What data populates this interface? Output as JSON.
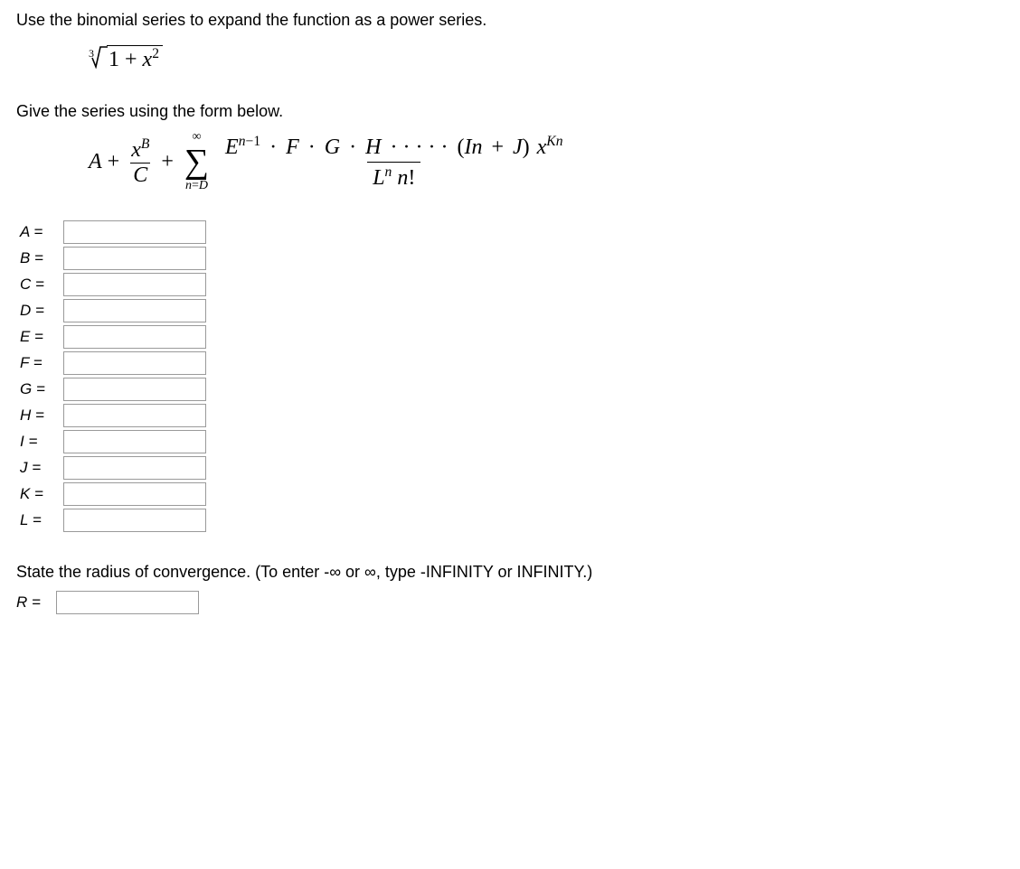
{
  "question": {
    "prompt1": "Use the binomial series to expand the function as a power series.",
    "root_index": "3",
    "radicand_prefix": "1 + ",
    "radicand_var": "x",
    "radicand_exp": "2",
    "prompt2": "Give the series using the form below.",
    "series": {
      "A": "A",
      "plus1": "+",
      "frac_num_var": "x",
      "frac_num_exp": "B",
      "frac_den": "C",
      "plus2": "+",
      "sigma_top": "∞",
      "sigma_sym": "∑",
      "sigma_bot_lhs": "n",
      "sigma_bot_eq": "=",
      "sigma_bot_rhs": "D",
      "big_num_E": "E",
      "big_num_E_exp_lhs": "n",
      "big_num_E_exp_op": "−",
      "big_num_E_exp_rhs": "1",
      "dot": "·",
      "F": "F",
      "G": "G",
      "H": "H",
      "dots": "· · · · ·",
      "lparen": "(",
      "I": "I",
      "n": "n",
      "plus3": "+",
      "J": "J",
      "rparen": ")",
      "x": "x",
      "Kn_K": "K",
      "Kn_n": "n",
      "den_L": "L",
      "den_L_exp": "n",
      "den_space": " ",
      "den_n": "n",
      "den_bang": "!"
    },
    "inputs": [
      {
        "label": "A ="
      },
      {
        "label": "B ="
      },
      {
        "label": "C ="
      },
      {
        "label": "D ="
      },
      {
        "label": "E ="
      },
      {
        "label": "F ="
      },
      {
        "label": "G ="
      },
      {
        "label": "H ="
      },
      {
        "label": "I ="
      },
      {
        "label": "J ="
      },
      {
        "label": "K ="
      },
      {
        "label": "L ="
      }
    ],
    "radius_prompt": "State the radius of convergence. (To enter -∞ or ∞, type -INFINITY or INFINITY.)",
    "radius_label": "R ="
  }
}
